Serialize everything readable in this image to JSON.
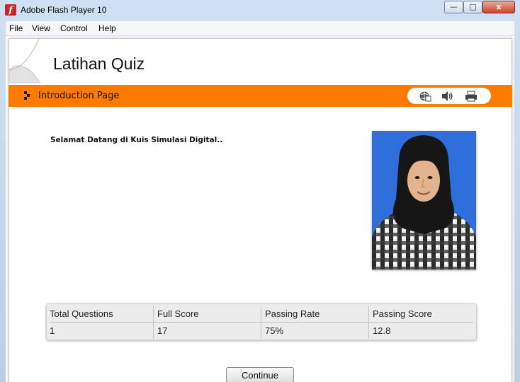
{
  "window": {
    "title": "Adobe Flash Player 10",
    "min_glyph": "—",
    "max_glyph": "□",
    "close_glyph": "x"
  },
  "menubar": {
    "items": [
      "File",
      "View",
      "Control",
      "Help"
    ]
  },
  "quiz": {
    "title": "Latihan Quiz",
    "section_label": "Introduction Page",
    "welcome_text": "Selamat Datang di Kuis Simulasi Digital..",
    "toolbar_icons": [
      "web-icon",
      "sound-icon",
      "print-icon"
    ]
  },
  "stats": {
    "headers": [
      "Total Questions",
      "Full Score",
      "Passing Rate",
      "Passing Score"
    ],
    "values": [
      "1",
      "17",
      "75%",
      "12.8"
    ]
  },
  "buttons": {
    "continue_label": "Continue"
  },
  "colors": {
    "accent": "#ff7b00",
    "photo_background": "#2f6fdc"
  }
}
